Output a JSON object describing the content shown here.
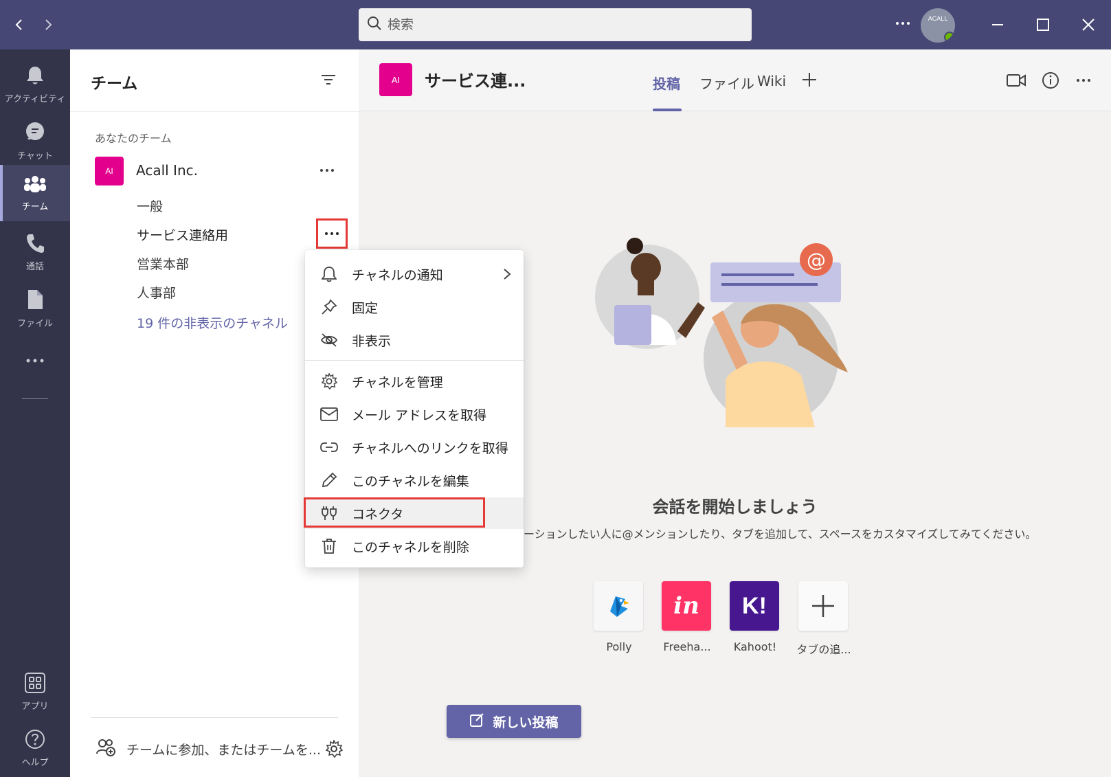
{
  "search": {
    "placeholder": "検索"
  },
  "user": {
    "avatar_text": "ACALL"
  },
  "rail": {
    "items": [
      {
        "label": "アクティビティ",
        "icon": "bell-icon"
      },
      {
        "label": "チャット",
        "icon": "chat-icon"
      },
      {
        "label": "チーム",
        "icon": "teams-icon",
        "active": true
      },
      {
        "label": "通話",
        "icon": "phone-icon"
      },
      {
        "label": "ファイル",
        "icon": "file-icon"
      }
    ],
    "more_label": "...",
    "apps_label": "アプリ",
    "help_label": "ヘルプ"
  },
  "teams_panel": {
    "title": "チーム",
    "section_label": "あなたのチーム",
    "team": {
      "avatar": "AI",
      "name": "Acall  Inc."
    },
    "channels": [
      "一般",
      "サービス連絡用",
      "営業本部",
      "人事部"
    ],
    "hidden_channels": "19 件の非表示のチャネル",
    "join_label": "チームに参加、またはチームを..."
  },
  "channel_header": {
    "avatar": "AI",
    "title": "サービス連...",
    "tabs": [
      {
        "label": "投稿",
        "active": true
      },
      {
        "label": "ファイル"
      },
      {
        "label": "Wiki"
      }
    ]
  },
  "context_menu": {
    "items": [
      {
        "label": "チャネルの通知",
        "icon": "bell-icon",
        "has_submenu": true
      },
      {
        "label": "固定",
        "icon": "pin-icon"
      },
      {
        "label": "非表示",
        "icon": "eye-off-icon"
      },
      {
        "label": "チャネルを管理",
        "icon": "gear-icon"
      },
      {
        "label": "メール アドレスを取得",
        "icon": "mail-icon"
      },
      {
        "label": "チャネルへのリンクを取得",
        "icon": "link-icon"
      },
      {
        "label": "このチャネルを編集",
        "icon": "pencil-icon"
      },
      {
        "label": "コネクタ",
        "icon": "connector-icon",
        "highlighted": true
      },
      {
        "label": "このチャネルを削除",
        "icon": "trash-icon"
      }
    ]
  },
  "main": {
    "start_title": "会話を開始しましょう",
    "start_desc": "ーションしたい人に@メンションしたり、タブを追加して、スペースをカスタマイズしてみてください。",
    "apps": [
      {
        "name": "Polly",
        "icon": "polly-icon"
      },
      {
        "name": "Freeha...",
        "icon": "invision-icon",
        "mark": "in"
      },
      {
        "name": "Kahoot!",
        "icon": "kahoot-icon",
        "mark": "K!"
      },
      {
        "name": "タブの追...",
        "icon": "plus-icon"
      }
    ],
    "new_post_label": "新しい投稿"
  },
  "colors": {
    "titlebar": "#464775",
    "rail": "#33344a",
    "brand": "#6264a7",
    "team_avatar": "#e3008c",
    "highlight": "#e53935"
  }
}
